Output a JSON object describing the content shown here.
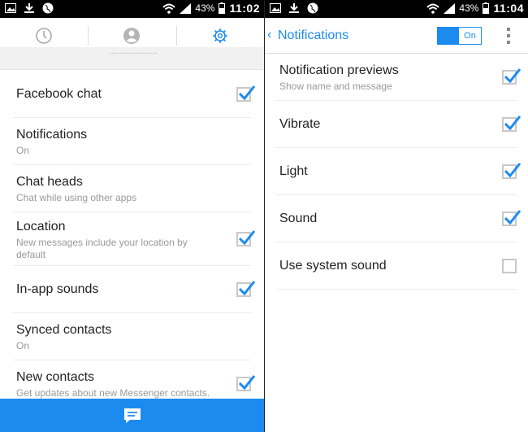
{
  "left": {
    "status": {
      "battery": "43%",
      "time": "11:02"
    },
    "tabs": [
      {
        "icon": "clock-icon",
        "active": false
      },
      {
        "icon": "person-icon",
        "active": false
      },
      {
        "icon": "gear-icon",
        "active": true
      }
    ],
    "cutoff_text": "………………",
    "settings": [
      {
        "title": "Facebook chat",
        "checked": true
      },
      {
        "title": "Notifications",
        "subtitle": "On"
      },
      {
        "title": "Chat heads",
        "subtitle": "Chat while using other apps"
      },
      {
        "title": "Location",
        "subtitle": "New messages include your location by default",
        "checked": true
      },
      {
        "title": "In-app sounds",
        "checked": true
      },
      {
        "title": "Synced contacts",
        "subtitle": "On"
      },
      {
        "title": "New contacts",
        "subtitle": "Get updates about new Messenger contacts.",
        "checked": true
      }
    ],
    "bottom_icon": "compose-message-icon"
  },
  "right": {
    "status": {
      "battery": "43%",
      "time": "11:04"
    },
    "header": {
      "title": "Notifications",
      "toggle_label": "On"
    },
    "settings": [
      {
        "title": "Notification previews",
        "subtitle": "Show name and message",
        "checked": true
      },
      {
        "title": "Vibrate",
        "checked": true
      },
      {
        "title": "Light",
        "checked": true
      },
      {
        "title": "Sound",
        "checked": true
      },
      {
        "title": "Use system sound",
        "checked": false
      }
    ]
  },
  "colors": {
    "accent": "#1b8bf0",
    "divider": "#ececec",
    "subtitle": "#999999"
  }
}
